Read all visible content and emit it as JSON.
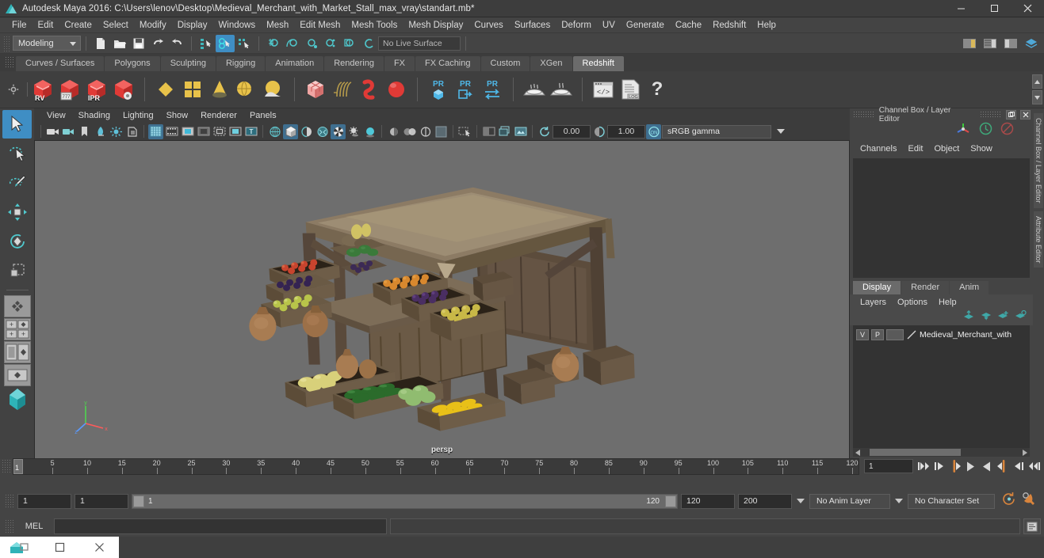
{
  "window": {
    "title": "Autodesk Maya 2016: C:\\Users\\lenov\\Desktop\\Medieval_Merchant_with_Market_Stall_max_vray\\standart.mb*",
    "app_icon": "maya-logo-icon",
    "buttons": {
      "minimize": "minimize-icon",
      "maximize": "maximize-icon",
      "close": "close-icon"
    }
  },
  "menubar": {
    "items": [
      "File",
      "Edit",
      "Create",
      "Select",
      "Modify",
      "Display",
      "Windows",
      "Mesh",
      "Edit Mesh",
      "Mesh Tools",
      "Mesh Display",
      "Curves",
      "Surfaces",
      "Deform",
      "UV",
      "Generate",
      "Cache",
      "Redshift",
      "Help"
    ]
  },
  "statusline": {
    "mode": "Modeling",
    "live_surface": "No Live Surface",
    "icons": [
      "new-scene-icon",
      "open-scene-icon",
      "save-scene-icon",
      "undo-icon",
      "redo-icon",
      "select-hierarchy-icon",
      "select-object-icon",
      "select-component-icon",
      "snap-grid-icon",
      "snap-curve-icon",
      "snap-point-icon",
      "snap-view-plane-icon",
      "snap-surface-icon",
      "make-live-icon"
    ],
    "right_icons": [
      "sidebar-channel-icon",
      "sidebar-attribute-icon",
      "sidebar-tool-icon",
      "sidebar-layers-icon"
    ]
  },
  "shelf": {
    "tabs": [
      "Curves / Surfaces",
      "Polygons",
      "Sculpting",
      "Rigging",
      "Animation",
      "Rendering",
      "FX",
      "FX Caching",
      "Custom",
      "XGen",
      "Redshift"
    ],
    "active_tab": "Redshift",
    "buttons": [
      {
        "name": "redshift-render-view",
        "label": "RV"
      },
      {
        "name": "redshift-render-sequence",
        "label": ""
      },
      {
        "name": "redshift-ipr",
        "label": "IPR"
      },
      {
        "name": "redshift-render-settings",
        "label": ""
      },
      {
        "name": "redshift-lights-area",
        "label": ""
      },
      {
        "name": "redshift-light-quad",
        "label": ""
      },
      {
        "name": "redshift-light-spot",
        "label": ""
      },
      {
        "name": "redshift-light-dome",
        "label": ""
      },
      {
        "name": "redshift-proxy-cube",
        "label": ""
      },
      {
        "name": "redshift-hair",
        "label": ""
      },
      {
        "name": "redshift-volume",
        "label": ""
      },
      {
        "name": "redshift-sphere",
        "label": ""
      },
      {
        "name": "redshift-pr-object",
        "label": "PR"
      },
      {
        "name": "redshift-pr-export",
        "label": "PR"
      },
      {
        "name": "redshift-pr-transfer",
        "label": "PR"
      },
      {
        "name": "redshift-bake-1",
        "label": ""
      },
      {
        "name": "redshift-bake-2",
        "label": ""
      },
      {
        "name": "redshift-script-editor",
        "label": ""
      },
      {
        "name": "redshift-log",
        "label": "LOG"
      },
      {
        "name": "redshift-help",
        "label": "?"
      }
    ]
  },
  "toolbox": {
    "items": [
      "select-tool",
      "lasso-select-tool",
      "paint-select-tool",
      "move-tool",
      "rotate-tool",
      "scale-tool",
      "last-tool",
      "quick-layout-four",
      "quick-layout-persp-outliner",
      "quick-layout-persp-graph",
      "quick-layout-persp-hypershade",
      "quick-layout-single",
      "maya-logo"
    ]
  },
  "viewport": {
    "menus": [
      "View",
      "Shading",
      "Lighting",
      "Show",
      "Renderer",
      "Panels"
    ],
    "camera_label": "persp",
    "toolbar": {
      "icons": [
        "select-camera-icon",
        "camera-attributes-icon",
        "bookmark-icon",
        "image-plane-icon",
        "two-sided-lighting-icon",
        "shadows-icon",
        "grid-icon",
        "film-gate-icon",
        "resolution-gate-icon",
        "gate-mask-icon",
        "field-chart-icon",
        "safe-action-icon",
        "safe-title-icon",
        "wireframe-icon",
        "smooth-shade-icon",
        "shaded-wireframe-icon",
        "hardware-texturing-icon",
        "use-all-lights-icon",
        "shadows-toggle-icon",
        "ao-icon",
        "motion-blur-icon",
        "multisample-icon",
        "depth-peel-icon",
        "xray-icon",
        "xray-joints-icon"
      ],
      "exposure": "0.00",
      "gamma": "1.00",
      "color_management": "sRGB gamma"
    },
    "background_color": "#6e6e6e",
    "scene_description": "Medieval merchant market stall 3D model with canvas awning, wooden crates of fruit and vegetables, and burlap sacks"
  },
  "channel_box": {
    "panel_title": "Channel Box / Layer Editor",
    "menus": [
      "Channels",
      "Edit",
      "Object",
      "Show"
    ],
    "icons": [
      "manipulator-icon",
      "clock-icon",
      "no-entry-icon"
    ],
    "side_tabs": [
      "Channel Box / Layer Editor",
      "Attribute Editor"
    ],
    "content": ""
  },
  "layer_editor": {
    "tabs": [
      "Display",
      "Render",
      "Anim"
    ],
    "active_tab": "Display",
    "menus": [
      "Layers",
      "Options",
      "Help"
    ],
    "buttons": [
      "move-layer-up-icon",
      "move-layer-down-icon",
      "new-layer-icon",
      "new-layer-from-selected-icon"
    ],
    "layers": [
      {
        "visibility": "V",
        "playback": "P",
        "state": "",
        "name": "Medieval_Merchant_with"
      }
    ]
  },
  "timeline": {
    "current_frame": "1",
    "frame_field": "1",
    "ticks": [
      5,
      10,
      15,
      20,
      25,
      30,
      35,
      40,
      45,
      50,
      55,
      60,
      65,
      70,
      75,
      80,
      85,
      90,
      95,
      100,
      105,
      110,
      115,
      120
    ],
    "start": 1,
    "end": 120,
    "playback_buttons": [
      "go-to-start-icon",
      "step-back-keyframe-icon",
      "step-back-frame-icon",
      "play-backwards-icon",
      "play-forwards-icon",
      "step-forward-frame-icon",
      "step-forward-keyframe-icon",
      "go-to-end-icon"
    ]
  },
  "range_slider": {
    "anim_start": "1",
    "range_start": "1",
    "bar_start_label": "1",
    "bar_end_label": "120",
    "range_end": "120",
    "anim_end": "200",
    "anim_layer": "No Anim Layer",
    "character_set": "No Character Set",
    "icons": [
      "auto-keyframe-icon",
      "animation-preferences-icon"
    ]
  },
  "command_line": {
    "language": "MEL",
    "input": "",
    "output": "",
    "script_editor_icon": "script-editor-icon"
  },
  "taskbar": {
    "items": [
      "maya-taskbar-icon",
      "restore-icon",
      "close-icon"
    ]
  },
  "colors": {
    "accent_blue": "#3f8ec4",
    "shelf_active": "#6b6b6b",
    "panel_bg": "#444444",
    "viewport_bg": "#6e6e6e",
    "redshift_red": "#e03a36",
    "teal": "#3fb8bd",
    "orange": "#d98a3a"
  }
}
